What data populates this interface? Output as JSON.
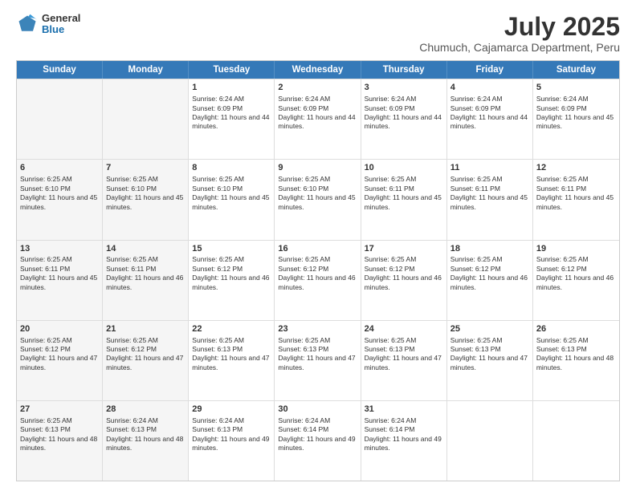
{
  "header": {
    "logo_general": "General",
    "logo_blue": "Blue",
    "title": "July 2025",
    "subtitle": "Chumuch, Cajamarca Department, Peru"
  },
  "weekdays": [
    "Sunday",
    "Monday",
    "Tuesday",
    "Wednesday",
    "Thursday",
    "Friday",
    "Saturday"
  ],
  "rows": [
    [
      {
        "day": "",
        "info": "",
        "shade": true
      },
      {
        "day": "",
        "info": "",
        "shade": true
      },
      {
        "day": "1",
        "info": "Sunrise: 6:24 AM\nSunset: 6:09 PM\nDaylight: 11 hours and 44 minutes.",
        "shade": false
      },
      {
        "day": "2",
        "info": "Sunrise: 6:24 AM\nSunset: 6:09 PM\nDaylight: 11 hours and 44 minutes.",
        "shade": false
      },
      {
        "day": "3",
        "info": "Sunrise: 6:24 AM\nSunset: 6:09 PM\nDaylight: 11 hours and 44 minutes.",
        "shade": false
      },
      {
        "day": "4",
        "info": "Sunrise: 6:24 AM\nSunset: 6:09 PM\nDaylight: 11 hours and 44 minutes.",
        "shade": false
      },
      {
        "day": "5",
        "info": "Sunrise: 6:24 AM\nSunset: 6:09 PM\nDaylight: 11 hours and 45 minutes.",
        "shade": false
      }
    ],
    [
      {
        "day": "6",
        "info": "Sunrise: 6:25 AM\nSunset: 6:10 PM\nDaylight: 11 hours and 45 minutes.",
        "shade": true
      },
      {
        "day": "7",
        "info": "Sunrise: 6:25 AM\nSunset: 6:10 PM\nDaylight: 11 hours and 45 minutes.",
        "shade": true
      },
      {
        "day": "8",
        "info": "Sunrise: 6:25 AM\nSunset: 6:10 PM\nDaylight: 11 hours and 45 minutes.",
        "shade": false
      },
      {
        "day": "9",
        "info": "Sunrise: 6:25 AM\nSunset: 6:10 PM\nDaylight: 11 hours and 45 minutes.",
        "shade": false
      },
      {
        "day": "10",
        "info": "Sunrise: 6:25 AM\nSunset: 6:11 PM\nDaylight: 11 hours and 45 minutes.",
        "shade": false
      },
      {
        "day": "11",
        "info": "Sunrise: 6:25 AM\nSunset: 6:11 PM\nDaylight: 11 hours and 45 minutes.",
        "shade": false
      },
      {
        "day": "12",
        "info": "Sunrise: 6:25 AM\nSunset: 6:11 PM\nDaylight: 11 hours and 45 minutes.",
        "shade": false
      }
    ],
    [
      {
        "day": "13",
        "info": "Sunrise: 6:25 AM\nSunset: 6:11 PM\nDaylight: 11 hours and 45 minutes.",
        "shade": true
      },
      {
        "day": "14",
        "info": "Sunrise: 6:25 AM\nSunset: 6:11 PM\nDaylight: 11 hours and 46 minutes.",
        "shade": true
      },
      {
        "day": "15",
        "info": "Sunrise: 6:25 AM\nSunset: 6:12 PM\nDaylight: 11 hours and 46 minutes.",
        "shade": false
      },
      {
        "day": "16",
        "info": "Sunrise: 6:25 AM\nSunset: 6:12 PM\nDaylight: 11 hours and 46 minutes.",
        "shade": false
      },
      {
        "day": "17",
        "info": "Sunrise: 6:25 AM\nSunset: 6:12 PM\nDaylight: 11 hours and 46 minutes.",
        "shade": false
      },
      {
        "day": "18",
        "info": "Sunrise: 6:25 AM\nSunset: 6:12 PM\nDaylight: 11 hours and 46 minutes.",
        "shade": false
      },
      {
        "day": "19",
        "info": "Sunrise: 6:25 AM\nSunset: 6:12 PM\nDaylight: 11 hours and 46 minutes.",
        "shade": false
      }
    ],
    [
      {
        "day": "20",
        "info": "Sunrise: 6:25 AM\nSunset: 6:12 PM\nDaylight: 11 hours and 47 minutes.",
        "shade": true
      },
      {
        "day": "21",
        "info": "Sunrise: 6:25 AM\nSunset: 6:12 PM\nDaylight: 11 hours and 47 minutes.",
        "shade": true
      },
      {
        "day": "22",
        "info": "Sunrise: 6:25 AM\nSunset: 6:13 PM\nDaylight: 11 hours and 47 minutes.",
        "shade": false
      },
      {
        "day": "23",
        "info": "Sunrise: 6:25 AM\nSunset: 6:13 PM\nDaylight: 11 hours and 47 minutes.",
        "shade": false
      },
      {
        "day": "24",
        "info": "Sunrise: 6:25 AM\nSunset: 6:13 PM\nDaylight: 11 hours and 47 minutes.",
        "shade": false
      },
      {
        "day": "25",
        "info": "Sunrise: 6:25 AM\nSunset: 6:13 PM\nDaylight: 11 hours and 47 minutes.",
        "shade": false
      },
      {
        "day": "26",
        "info": "Sunrise: 6:25 AM\nSunset: 6:13 PM\nDaylight: 11 hours and 48 minutes.",
        "shade": false
      }
    ],
    [
      {
        "day": "27",
        "info": "Sunrise: 6:25 AM\nSunset: 6:13 PM\nDaylight: 11 hours and 48 minutes.",
        "shade": true
      },
      {
        "day": "28",
        "info": "Sunrise: 6:24 AM\nSunset: 6:13 PM\nDaylight: 11 hours and 48 minutes.",
        "shade": true
      },
      {
        "day": "29",
        "info": "Sunrise: 6:24 AM\nSunset: 6:13 PM\nDaylight: 11 hours and 49 minutes.",
        "shade": false
      },
      {
        "day": "30",
        "info": "Sunrise: 6:24 AM\nSunset: 6:14 PM\nDaylight: 11 hours and 49 minutes.",
        "shade": false
      },
      {
        "day": "31",
        "info": "Sunrise: 6:24 AM\nSunset: 6:14 PM\nDaylight: 11 hours and 49 minutes.",
        "shade": false
      },
      {
        "day": "",
        "info": "",
        "shade": false
      },
      {
        "day": "",
        "info": "",
        "shade": false
      }
    ]
  ]
}
